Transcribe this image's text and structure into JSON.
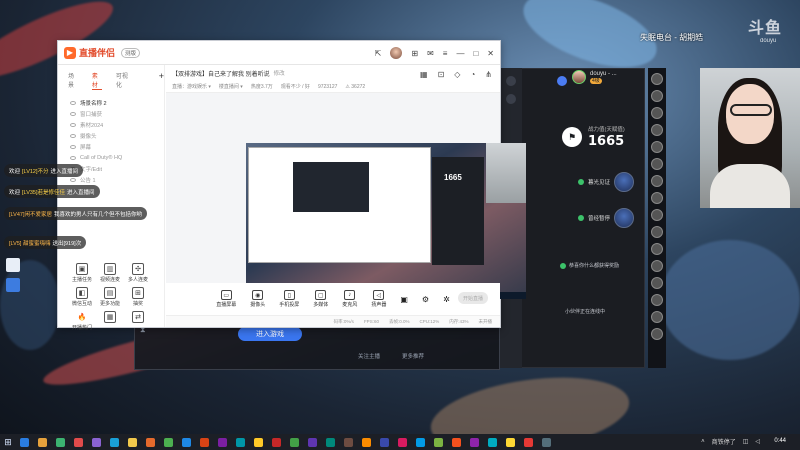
{
  "wallpaper": {
    "overlay_title": "失眠电台 - 胡期皓",
    "logo": "斗鱼",
    "logo_sub": "douyu"
  },
  "front_window": {
    "brand": "直播伴侣",
    "version": "测版",
    "left_tabs": [
      "场景",
      "素材",
      "可视化"
    ],
    "scenes": [
      {
        "label": "场景名称 2",
        "active": true
      },
      {
        "label": "窗口捕获",
        "active": false
      },
      {
        "label": "素材2024",
        "active": false
      },
      {
        "label": "摄像头",
        "active": false
      },
      {
        "label": "屏幕",
        "active": false
      },
      {
        "label": "Call of Duty® HQ",
        "active": false
      },
      {
        "label": "文字/Edit",
        "active": false
      },
      {
        "label": "公告 1",
        "active": false
      }
    ],
    "tools": [
      {
        "icon": "gamepad-icon",
        "glyph": "▣",
        "label": "主播任务"
      },
      {
        "icon": "video-link-icon",
        "glyph": "▥",
        "label": "视频连麦"
      },
      {
        "icon": "multi-user-icon",
        "glyph": "✣",
        "label": "多人连麦"
      },
      {
        "icon": "interactive-icon",
        "glyph": "◧",
        "label": "微信互动"
      },
      {
        "icon": "gift-icon",
        "glyph": "▤",
        "label": "更多功能"
      },
      {
        "icon": "fan-icon",
        "glyph": "⊞",
        "label": "抽奖"
      },
      {
        "icon": "hot-icon",
        "glyph": "🔥",
        "label": "开播热门"
      },
      {
        "icon": "note-icon",
        "glyph": "▦",
        "label": ""
      },
      {
        "icon": "link-icon",
        "glyph": "⇄",
        "label": ""
      }
    ],
    "stream_title": "【双排游戏】自己来了解我 别着听说",
    "stream_tag": "修改",
    "sub_fields": [
      "直播：游戏娱乐 ▾",
      "楼直播间 ▾",
      "热度3.7万",
      "观看不少 / 好",
      "9723127",
      "⚠ 36272"
    ],
    "bottom_buttons": [
      {
        "icon": "screen-share-icon",
        "glyph": "▭",
        "label": "直播屏幕"
      },
      {
        "icon": "camera-icon",
        "glyph": "◉",
        "label": "摄像头"
      },
      {
        "icon": "phone-icon",
        "glyph": "▯",
        "label": "手机投屏"
      },
      {
        "icon": "window-icon",
        "glyph": "▢",
        "label": "多媒体"
      },
      {
        "icon": "mic-icon",
        "glyph": "♪",
        "label": "麦克风"
      },
      {
        "icon": "speaker-icon",
        "glyph": "◁",
        "label": "扬声器"
      }
    ],
    "start_button": "开始直播",
    "status_items": [
      "码率:0%/s",
      "FPS:60",
      "丢帧:0.0%",
      "CPU:12%",
      "内存:43%",
      "未开播"
    ]
  },
  "back_window": {
    "enter_button": "进入游戏",
    "links": [
      "关注主播",
      "更多推荐"
    ]
  },
  "chat_panel": {
    "username": "douyu - ...",
    "level": "4级",
    "power_label": "战力值(天赋值)",
    "power_value": "1665",
    "ranks": [
      "暮光见证",
      "曾经暂停"
    ],
    "messages": [
      "恭喜你什么都获得奖励",
      "小伙伴正在连线中"
    ]
  },
  "chat_bubbles": [
    {
      "text": "欢迎",
      "name": "[LV12]不分",
      "tail": "进入直播间"
    },
    {
      "text": "欢迎",
      "name": "[LV35]若是修佳佳",
      "tail": "进入直播间"
    },
    {
      "text": "",
      "name": "[LV47]闲不爱家居",
      "tail": "我喜欢的男人只有几个但不包括你哟"
    },
    {
      "text": "",
      "name": "[LV5] 甜蜜蜜嗨嗨",
      "tail": "送出[919]次"
    }
  ],
  "preview": {
    "power_value": "1665"
  },
  "taskbar": {
    "tray_text": "商铁停了",
    "clock": "0:44",
    "apps": [
      "#2a7de1",
      "#e6a23c",
      "#3cb371",
      "#e14b4b",
      "#8a63d2",
      "#19a0d8",
      "#f2c94c",
      "#e66a2c",
      "#4caf50",
      "#1e88e5",
      "#d84315",
      "#7b1fa2",
      "#0097a7",
      "#ffca28",
      "#c62828",
      "#43a047",
      "#5e35b1",
      "#00897b",
      "#6d4c41",
      "#fb8c00",
      "#3949ab",
      "#d81b60",
      "#039be5",
      "#7cb342",
      "#f4511e",
      "#8e24aa",
      "#00acc1",
      "#fdd835",
      "#e53935",
      "#546e7a"
    ]
  }
}
